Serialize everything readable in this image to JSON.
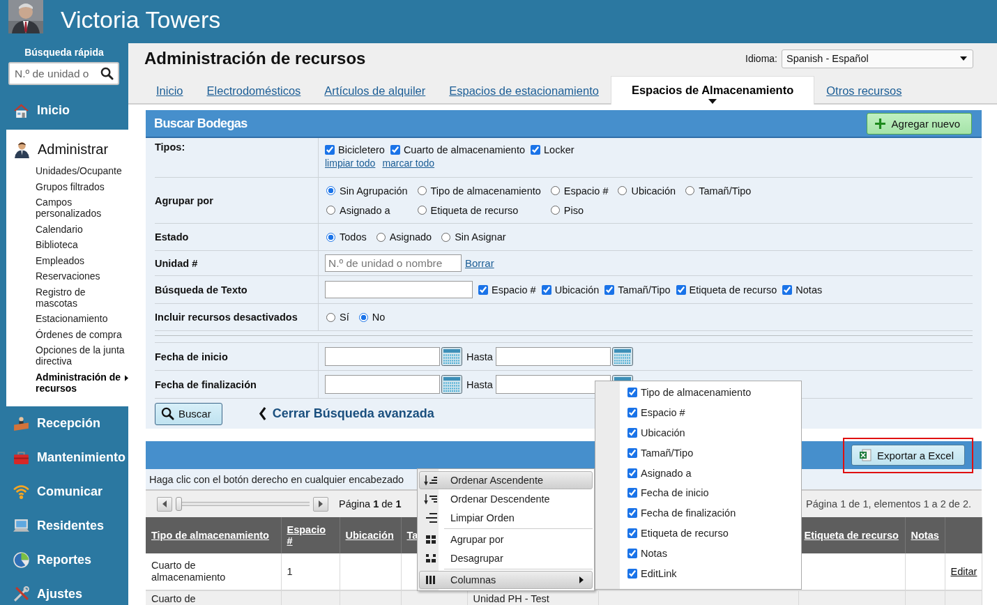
{
  "header": {
    "title": "Victoria Towers"
  },
  "sidebar": {
    "quick_search": {
      "label": "Búsqueda rápida",
      "placeholder": "N.º de unidad o"
    },
    "nav": [
      {
        "label": "Inicio",
        "expanded": false
      },
      {
        "label": "Administrar",
        "expanded": true,
        "children": [
          {
            "label": "Unidades/Ocupante",
            "selected": false
          },
          {
            "label": "Grupos filtrados",
            "selected": false
          },
          {
            "label": "Campos personalizados",
            "selected": false
          },
          {
            "label": "Calendario",
            "selected": false
          },
          {
            "label": "Biblioteca",
            "selected": false
          },
          {
            "label": "Empleados",
            "selected": false
          },
          {
            "label": "Reservaciones",
            "selected": false
          },
          {
            "label": "Registro de mascotas",
            "selected": false
          },
          {
            "label": "Estacionamiento",
            "selected": false
          },
          {
            "label": "Órdenes de compra",
            "selected": false
          },
          {
            "label": "Opciones de la junta directiva",
            "selected": false
          },
          {
            "label": "Administración de recursos",
            "selected": true
          }
        ]
      },
      {
        "label": "Recepción",
        "expanded": false
      },
      {
        "label": "Mantenimiento",
        "expanded": false
      },
      {
        "label": "Comunicar",
        "expanded": false
      },
      {
        "label": "Residentes",
        "expanded": false
      },
      {
        "label": "Reportes",
        "expanded": false
      },
      {
        "label": "Ajustes",
        "expanded": false
      }
    ]
  },
  "page": {
    "title": "Administración de recursos",
    "language": {
      "label": "Idioma:",
      "value": "Spanish - Español"
    },
    "tabs": [
      {
        "label": "Inicio",
        "selected": false
      },
      {
        "label": "Electrodomésticos",
        "selected": false
      },
      {
        "label": "Artículos de alquiler",
        "selected": false
      },
      {
        "label": "Espacios de estacionamiento",
        "selected": false
      },
      {
        "label": "Espacios de Almacenamiento",
        "selected": true
      },
      {
        "label": "Otros recursos",
        "selected": false
      }
    ]
  },
  "search": {
    "title": "Buscar Bodegas",
    "add_button": "Agregar nuevo",
    "rows": [
      {
        "label": "Tipos:",
        "kind": "checks",
        "options": [
          {
            "label": "Bicicletero",
            "checked": true
          },
          {
            "label": "Cuarto de almacenamiento",
            "checked": true
          },
          {
            "label": "Locker",
            "checked": true
          }
        ],
        "links": [
          "limpiar todo",
          "marcar todo"
        ]
      },
      {
        "label": "Agrupar por",
        "kind": "radios",
        "options": [
          {
            "label": "Sin Agrupación",
            "selected": true
          },
          {
            "label": "Tipo de almacenamiento",
            "selected": false
          },
          {
            "label": "Espacio #",
            "selected": false
          },
          {
            "label": "Ubicación",
            "selected": false
          },
          {
            "label": "Tamañ/Tipo",
            "selected": false
          },
          {
            "label": "Asignado a",
            "selected": false
          },
          {
            "label": "Etiqueta de recurso",
            "selected": false
          },
          {
            "label": "Piso",
            "selected": false
          }
        ]
      },
      {
        "label": "Estado",
        "kind": "radios",
        "options": [
          {
            "label": "Todos",
            "selected": true
          },
          {
            "label": "Asignado",
            "selected": false
          },
          {
            "label": "Sin Asignar",
            "selected": false
          }
        ]
      },
      {
        "label": "Unidad #",
        "kind": "unit",
        "placeholder": "N.º de unidad o nombre",
        "link": "Borrar"
      },
      {
        "label": "Búsqueda de Texto",
        "kind": "text_search",
        "options": [
          {
            "label": "Espacio #",
            "checked": true
          },
          {
            "label": "Ubicación",
            "checked": true
          },
          {
            "label": "Tamañ/Tipo",
            "checked": true
          },
          {
            "label": "Etiqueta de recurso",
            "checked": true
          },
          {
            "label": "Notas",
            "checked": true
          }
        ]
      },
      {
        "label": "Incluir recursos desactivados",
        "kind": "radios",
        "options": [
          {
            "label": "Sí",
            "selected": false
          },
          {
            "label": "No",
            "selected": true
          }
        ]
      },
      {
        "kind": "separator"
      },
      {
        "label": "Fecha de inicio",
        "kind": "date_range",
        "between": "Hasta"
      },
      {
        "label": "Fecha de finalización",
        "kind": "date_range",
        "between": "Hasta"
      }
    ],
    "search_button": "Buscar",
    "collapse_link": "Cerrar Búsqueda avanzada"
  },
  "results": {
    "export_button": "Exportar a Excel",
    "hint": "Haga clic con el botón derecho en cualquier encabezado",
    "pager": {
      "level": 0,
      "text": "Página **1** de **1**",
      "summary": "Página 1 de 1, elementos 1 a 2 de 2."
    },
    "columns": [
      {
        "label": "Tipo de almacenamiento"
      },
      {
        "label": "Espacio #"
      },
      {
        "label": "Ubicación"
      },
      {
        "label": "Ta"
      },
      {},
      {},
      {
        "label": "Etiqueta de recurso"
      },
      {
        "label": "Notas"
      },
      {}
    ],
    "rows": [
      {
        "cells": [
          "Cuarto de almacenamiento",
          "1",
          null,
          null,
          null,
          null,
          null,
          null,
          "Editar"
        ]
      },
      {
        "cells": [
          "Cuarto de",
          null,
          null,
          null,
          "Unidad PH - Test",
          null,
          null,
          null,
          null
        ]
      }
    ]
  },
  "context_menu": {
    "items": [
      {
        "kind": "item",
        "label": "Ordenar Ascendente",
        "highlighted": true
      },
      {
        "kind": "item",
        "label": "Ordenar Descendente",
        "highlighted": false
      },
      {
        "kind": "item",
        "label": "Limpiar Orden",
        "highlighted": false
      },
      {
        "kind": "separator"
      },
      {
        "kind": "item",
        "label": "Agrupar por",
        "highlighted": false
      },
      {
        "kind": "item",
        "label": "Desagrupar",
        "highlighted": false
      },
      {
        "kind": "separator"
      },
      {
        "kind": "submenu",
        "label": "Columnas",
        "highlighted": true
      }
    ]
  },
  "columns_menu": {
    "items": [
      {
        "label": "Tipo de almacenamiento",
        "checked": true
      },
      {
        "label": "Espacio #",
        "checked": true
      },
      {
        "label": "Ubicación",
        "checked": true
      },
      {
        "label": "Tamañ/Tipo",
        "checked": true
      },
      {
        "label": "Asignado a",
        "checked": true
      },
      {
        "label": "Fecha de inicio",
        "checked": true
      },
      {
        "label": "Fecha de finalización",
        "checked": true
      },
      {
        "label": "Etiqueta de recurso",
        "checked": true
      },
      {
        "label": "Notas",
        "checked": true
      },
      {
        "label": "EditLink",
        "checked": true
      }
    ]
  }
}
